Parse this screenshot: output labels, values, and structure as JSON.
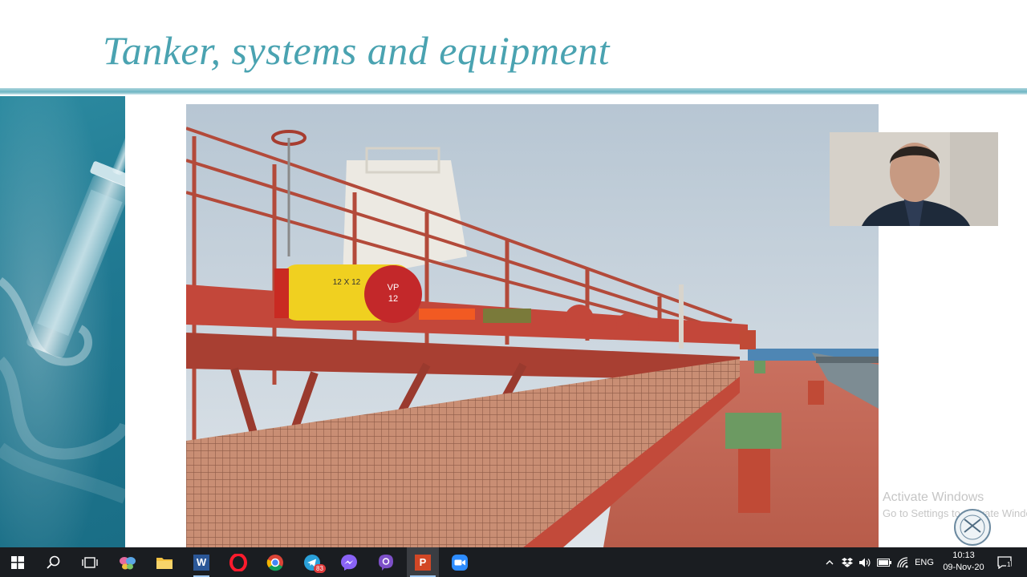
{
  "slide": {
    "title": "Tanker, systems and equipment",
    "photo_alt_texts": {
      "pipe_label_1": "VP",
      "pipe_label_2": "12",
      "pipe_size": "12 X 12"
    }
  },
  "watermark": {
    "line1": "Activate Windows",
    "line2": "Go to Settings to activate Windows."
  },
  "taskbar": {
    "apps": [
      {
        "name": "start",
        "icon": "windows-logo-icon"
      },
      {
        "name": "search",
        "icon": "search-icon"
      },
      {
        "name": "task-view",
        "icon": "task-view-icon"
      },
      {
        "name": "app-unknown",
        "icon": "butterfly-app-icon"
      },
      {
        "name": "file-explorer",
        "icon": "folder-icon"
      },
      {
        "name": "word",
        "icon": "word-icon",
        "letter": "W"
      },
      {
        "name": "opera",
        "icon": "opera-icon"
      },
      {
        "name": "chrome",
        "icon": "chrome-icon"
      },
      {
        "name": "telegram",
        "icon": "telegram-icon",
        "badge": "83"
      },
      {
        "name": "messenger",
        "icon": "messenger-icon"
      },
      {
        "name": "viber",
        "icon": "viber-icon"
      },
      {
        "name": "powerpoint",
        "icon": "powerpoint-icon",
        "letter": "P"
      },
      {
        "name": "zoom",
        "icon": "zoom-icon"
      }
    ],
    "language": "ENG",
    "time": "10:13",
    "date": "09-Nov-20",
    "notification_count": "1"
  }
}
